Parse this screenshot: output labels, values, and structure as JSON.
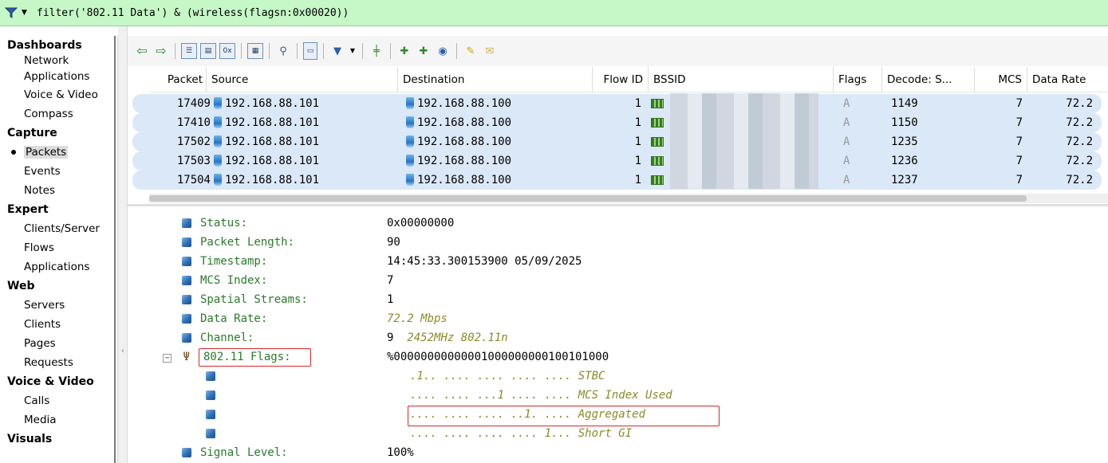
{
  "filter": {
    "expression": "filter('802.11 Data') & (wireless(flagsn:0x00020))"
  },
  "sidebar": {
    "groups": [
      {
        "label": "Dashboards",
        "items": [
          "Network",
          "Applications",
          "Voice & Video",
          "Compass"
        ]
      },
      {
        "label": "Capture",
        "items": [
          "Packets",
          "Events",
          "Notes"
        ]
      },
      {
        "label": "Expert",
        "items": [
          "Clients/Server",
          "Flows",
          "Applications"
        ]
      },
      {
        "label": "Web",
        "items": [
          "Servers",
          "Clients",
          "Pages",
          "Requests"
        ]
      },
      {
        "label": "Voice & Video",
        "items": [
          "Calls",
          "Media"
        ]
      },
      {
        "label": "Visuals",
        "items": []
      }
    ],
    "selected": "Packets"
  },
  "table": {
    "columns": [
      "Packet",
      "Source",
      "Destination",
      "Flow ID",
      "BSSID",
      "Flags",
      "Decode: S...",
      "MCS",
      "Data Rate"
    ],
    "rows": [
      {
        "packet": "17409",
        "source": "192.168.88.101",
        "destination": "192.168.88.100",
        "flow_id": "1",
        "flags": "A",
        "decode": "1149",
        "mcs": "7",
        "rate": "72.2"
      },
      {
        "packet": "17410",
        "source": "192.168.88.101",
        "destination": "192.168.88.100",
        "flow_id": "1",
        "flags": "A",
        "decode": "1150",
        "mcs": "7",
        "rate": "72.2"
      },
      {
        "packet": "17502",
        "source": "192.168.88.101",
        "destination": "192.168.88.100",
        "flow_id": "1",
        "flags": "A",
        "decode": "1235",
        "mcs": "7",
        "rate": "72.2"
      },
      {
        "packet": "17503",
        "source": "192.168.88.101",
        "destination": "192.168.88.100",
        "flow_id": "1",
        "flags": "A",
        "decode": "1236",
        "mcs": "7",
        "rate": "72.2"
      },
      {
        "packet": "17504",
        "source": "192.168.88.101",
        "destination": "192.168.88.100",
        "flow_id": "1",
        "flags": "A",
        "decode": "1237",
        "mcs": "7",
        "rate": "72.2"
      }
    ]
  },
  "detail": {
    "fields": [
      {
        "label": "Status:",
        "value": "0x00000000",
        "italic": false
      },
      {
        "label": "Packet Length:",
        "value": "90",
        "italic": false
      },
      {
        "label": "Timestamp:",
        "value": "14:45:33.300153900 05/09/2025",
        "italic": false
      },
      {
        "label": "MCS Index:",
        "value": "7",
        "italic": false
      },
      {
        "label": "Spatial Streams:",
        "value": "1",
        "italic": false
      },
      {
        "label": "Data Rate:",
        "value": "72.2 Mbps",
        "italic": true
      },
      {
        "label": "Channel:",
        "value": "9",
        "extra": "2452MHz  802.11n"
      }
    ],
    "flags": {
      "label": "802.11 Flags:",
      "value": "%00000000000001000000000100101000",
      "bits": [
        ".1.. .... .... .... .... STBC",
        ".... .... ...1 .... .... MCS Index Used",
        ".... .... .... ..1. .... Aggregated",
        ".... .... .... .... 1... Short GI"
      ]
    },
    "signal": {
      "label": "Signal Level:",
      "value": "100%"
    }
  },
  "colors": {
    "filter_bg": "#c6f7c6",
    "row_bg": "#dbe8f7",
    "field_label": "#2a7a2a",
    "highlight": "#d9262b"
  }
}
